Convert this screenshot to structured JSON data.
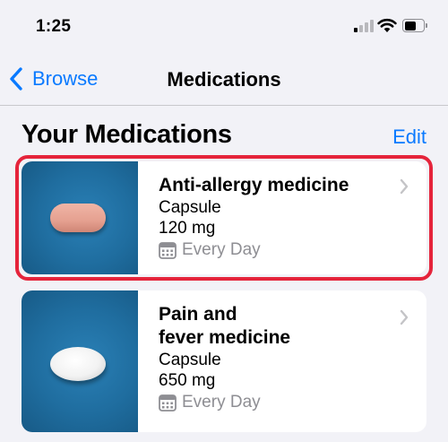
{
  "status_bar": {
    "time": "1:25"
  },
  "nav": {
    "back_label": "Browse",
    "title": "Medications"
  },
  "section": {
    "title": "Your Medications",
    "edit_label": "Edit"
  },
  "medications": [
    {
      "name": "Anti-allergy medicine",
      "form": "Capsule",
      "dose": "120 mg",
      "schedule": "Every Day",
      "pill_color": "#e8a595"
    },
    {
      "name": "Pain and\nfever medicine",
      "form": "Capsule",
      "dose": "650 mg",
      "schedule": "Every Day",
      "pill_color": "#f4f4f4"
    }
  ],
  "colors": {
    "accent": "#0a7aff",
    "highlight": "#e5243b",
    "thumb_blue": "#1f6d9f"
  }
}
